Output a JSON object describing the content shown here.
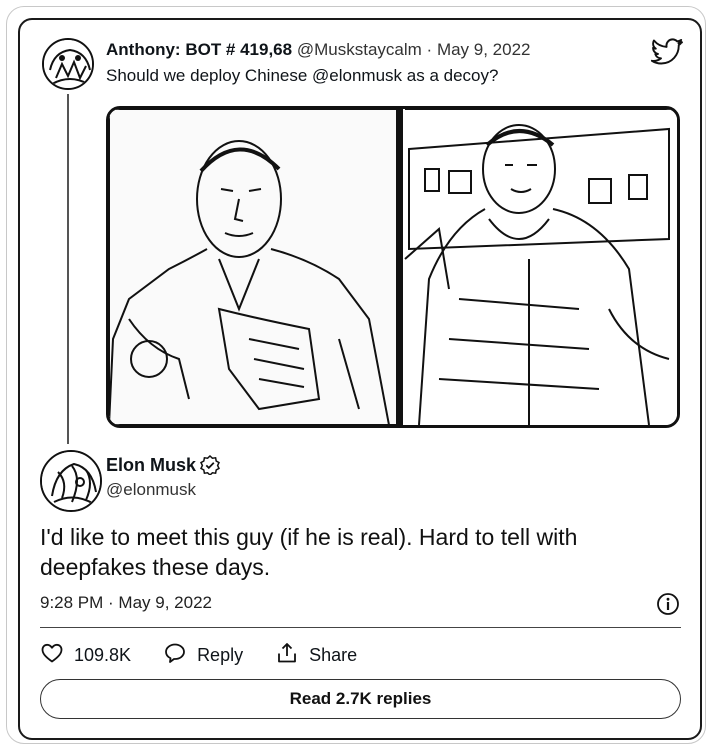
{
  "quoted_tweet": {
    "author_name": "Anthony: BOT # 419,68",
    "handle": "@Muskstaycalm",
    "separator": "·",
    "date": "May 9, 2022",
    "text": "Should we deploy Chinese @elonmusk as a decoy?",
    "media_description_icon": "photo-collage-icon"
  },
  "main_tweet": {
    "author_name": "Elon Musk",
    "handle": "@elonmusk",
    "text": "I'd like to meet this guy (if he is real). Hard to tell with deepfakes these days.",
    "timestamp": "9:28 PM · May 9, 2022"
  },
  "actions": {
    "likes_count": "109.8K",
    "reply_label": "Reply",
    "share_label": "Share"
  },
  "read_replies_label": "Read 2.7K replies",
  "icons": {
    "logo": "twitter-bird-icon",
    "verified": "verified-badge-icon",
    "info": "info-icon",
    "like": "heart-icon",
    "reply": "speech-bubble-icon",
    "share": "share-arrow-icon"
  },
  "colors": {
    "text": "#0f1419",
    "border": "#1a1a1a",
    "background": "#ffffff"
  }
}
